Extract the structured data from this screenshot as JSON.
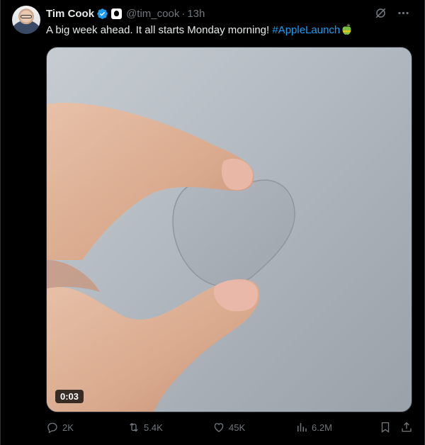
{
  "author": {
    "name": "Tim Cook",
    "handle": "@tim_cook",
    "separator": "·",
    "time": "13h"
  },
  "tweet": {
    "text": "A big week ahead. It all starts Monday morning!",
    "hashtag": "#AppleLaunch",
    "emoji": "green-apple-emoji"
  },
  "media": {
    "video_time": "0:03"
  },
  "actions": {
    "replies": "2K",
    "retweets": "5.4K",
    "likes": "45K",
    "views": "6.2M"
  },
  "colors": {
    "background": "#000000",
    "text": "#e7e9ea",
    "muted": "#71767b",
    "link": "#1d9bf0",
    "verified": "#1d9bf0"
  }
}
